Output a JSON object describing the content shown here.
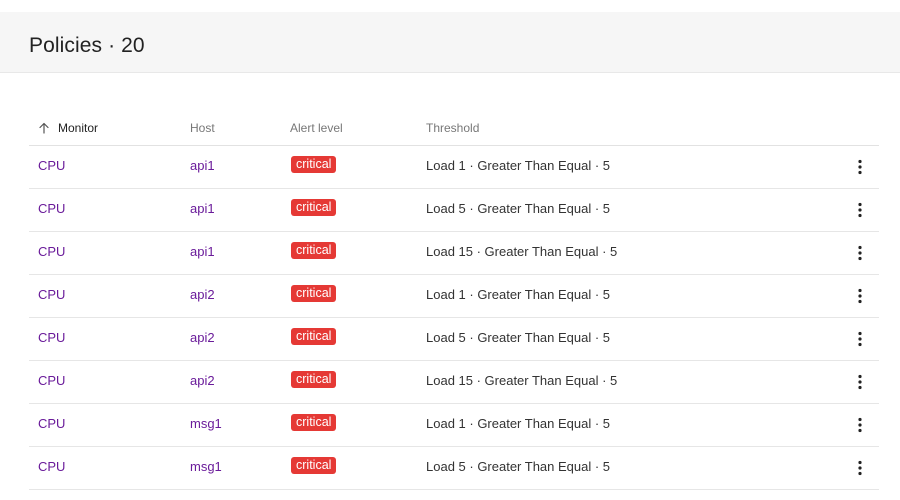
{
  "header": {
    "title": "Policies · 20"
  },
  "table": {
    "columns": {
      "monitor": "Monitor",
      "host": "Host",
      "alert_level": "Alert level",
      "threshold": "Threshold"
    },
    "sort_icon": "arrow-up-icon",
    "row_menu_icon": "more-vertical-icon",
    "rows": [
      {
        "monitor": "CPU",
        "host": "api1",
        "alert_level": "critical",
        "threshold": "Load 1 · Greater Than Equal · 5"
      },
      {
        "monitor": "CPU",
        "host": "api1",
        "alert_level": "critical",
        "threshold": "Load 5 · Greater Than Equal · 5"
      },
      {
        "monitor": "CPU",
        "host": "api1",
        "alert_level": "critical",
        "threshold": "Load 15 · Greater Than Equal · 5"
      },
      {
        "monitor": "CPU",
        "host": "api2",
        "alert_level": "critical",
        "threshold": "Load 1 · Greater Than Equal · 5"
      },
      {
        "monitor": "CPU",
        "host": "api2",
        "alert_level": "critical",
        "threshold": "Load 5 · Greater Than Equal · 5"
      },
      {
        "monitor": "CPU",
        "host": "api2",
        "alert_level": "critical",
        "threshold": "Load 15 · Greater Than Equal · 5"
      },
      {
        "monitor": "CPU",
        "host": "msg1",
        "alert_level": "critical",
        "threshold": "Load 1 · Greater Than Equal · 5"
      },
      {
        "monitor": "CPU",
        "host": "msg1",
        "alert_level": "critical",
        "threshold": "Load 5 · Greater Than Equal · 5"
      }
    ]
  },
  "colors": {
    "link": "#6a1b9a",
    "critical_badge": "#e53935",
    "header_bg": "#f6f6f6"
  }
}
